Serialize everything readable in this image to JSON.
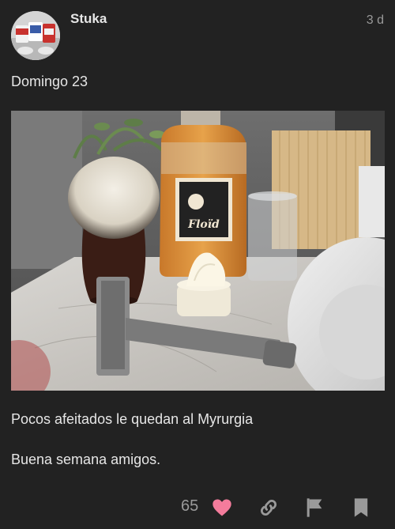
{
  "post": {
    "username": "Stuka",
    "age": "3 d",
    "paragraphs": {
      "p1": "Domingo 23",
      "p2": "Pocos afeitados le quedan al Myrurgia",
      "p3": "Buena semana amigos."
    },
    "photo": {
      "bottle_label": "Floïd"
    },
    "actions": {
      "like_count": "65"
    }
  },
  "colors": {
    "background": "#222222",
    "text": "#e6e6e6",
    "muted": "#9a9a9a",
    "heart": "#f47c9c",
    "icon": "#9a9a9a"
  },
  "icons": [
    "heart-icon",
    "link-icon",
    "flag-icon",
    "bookmark-icon"
  ]
}
